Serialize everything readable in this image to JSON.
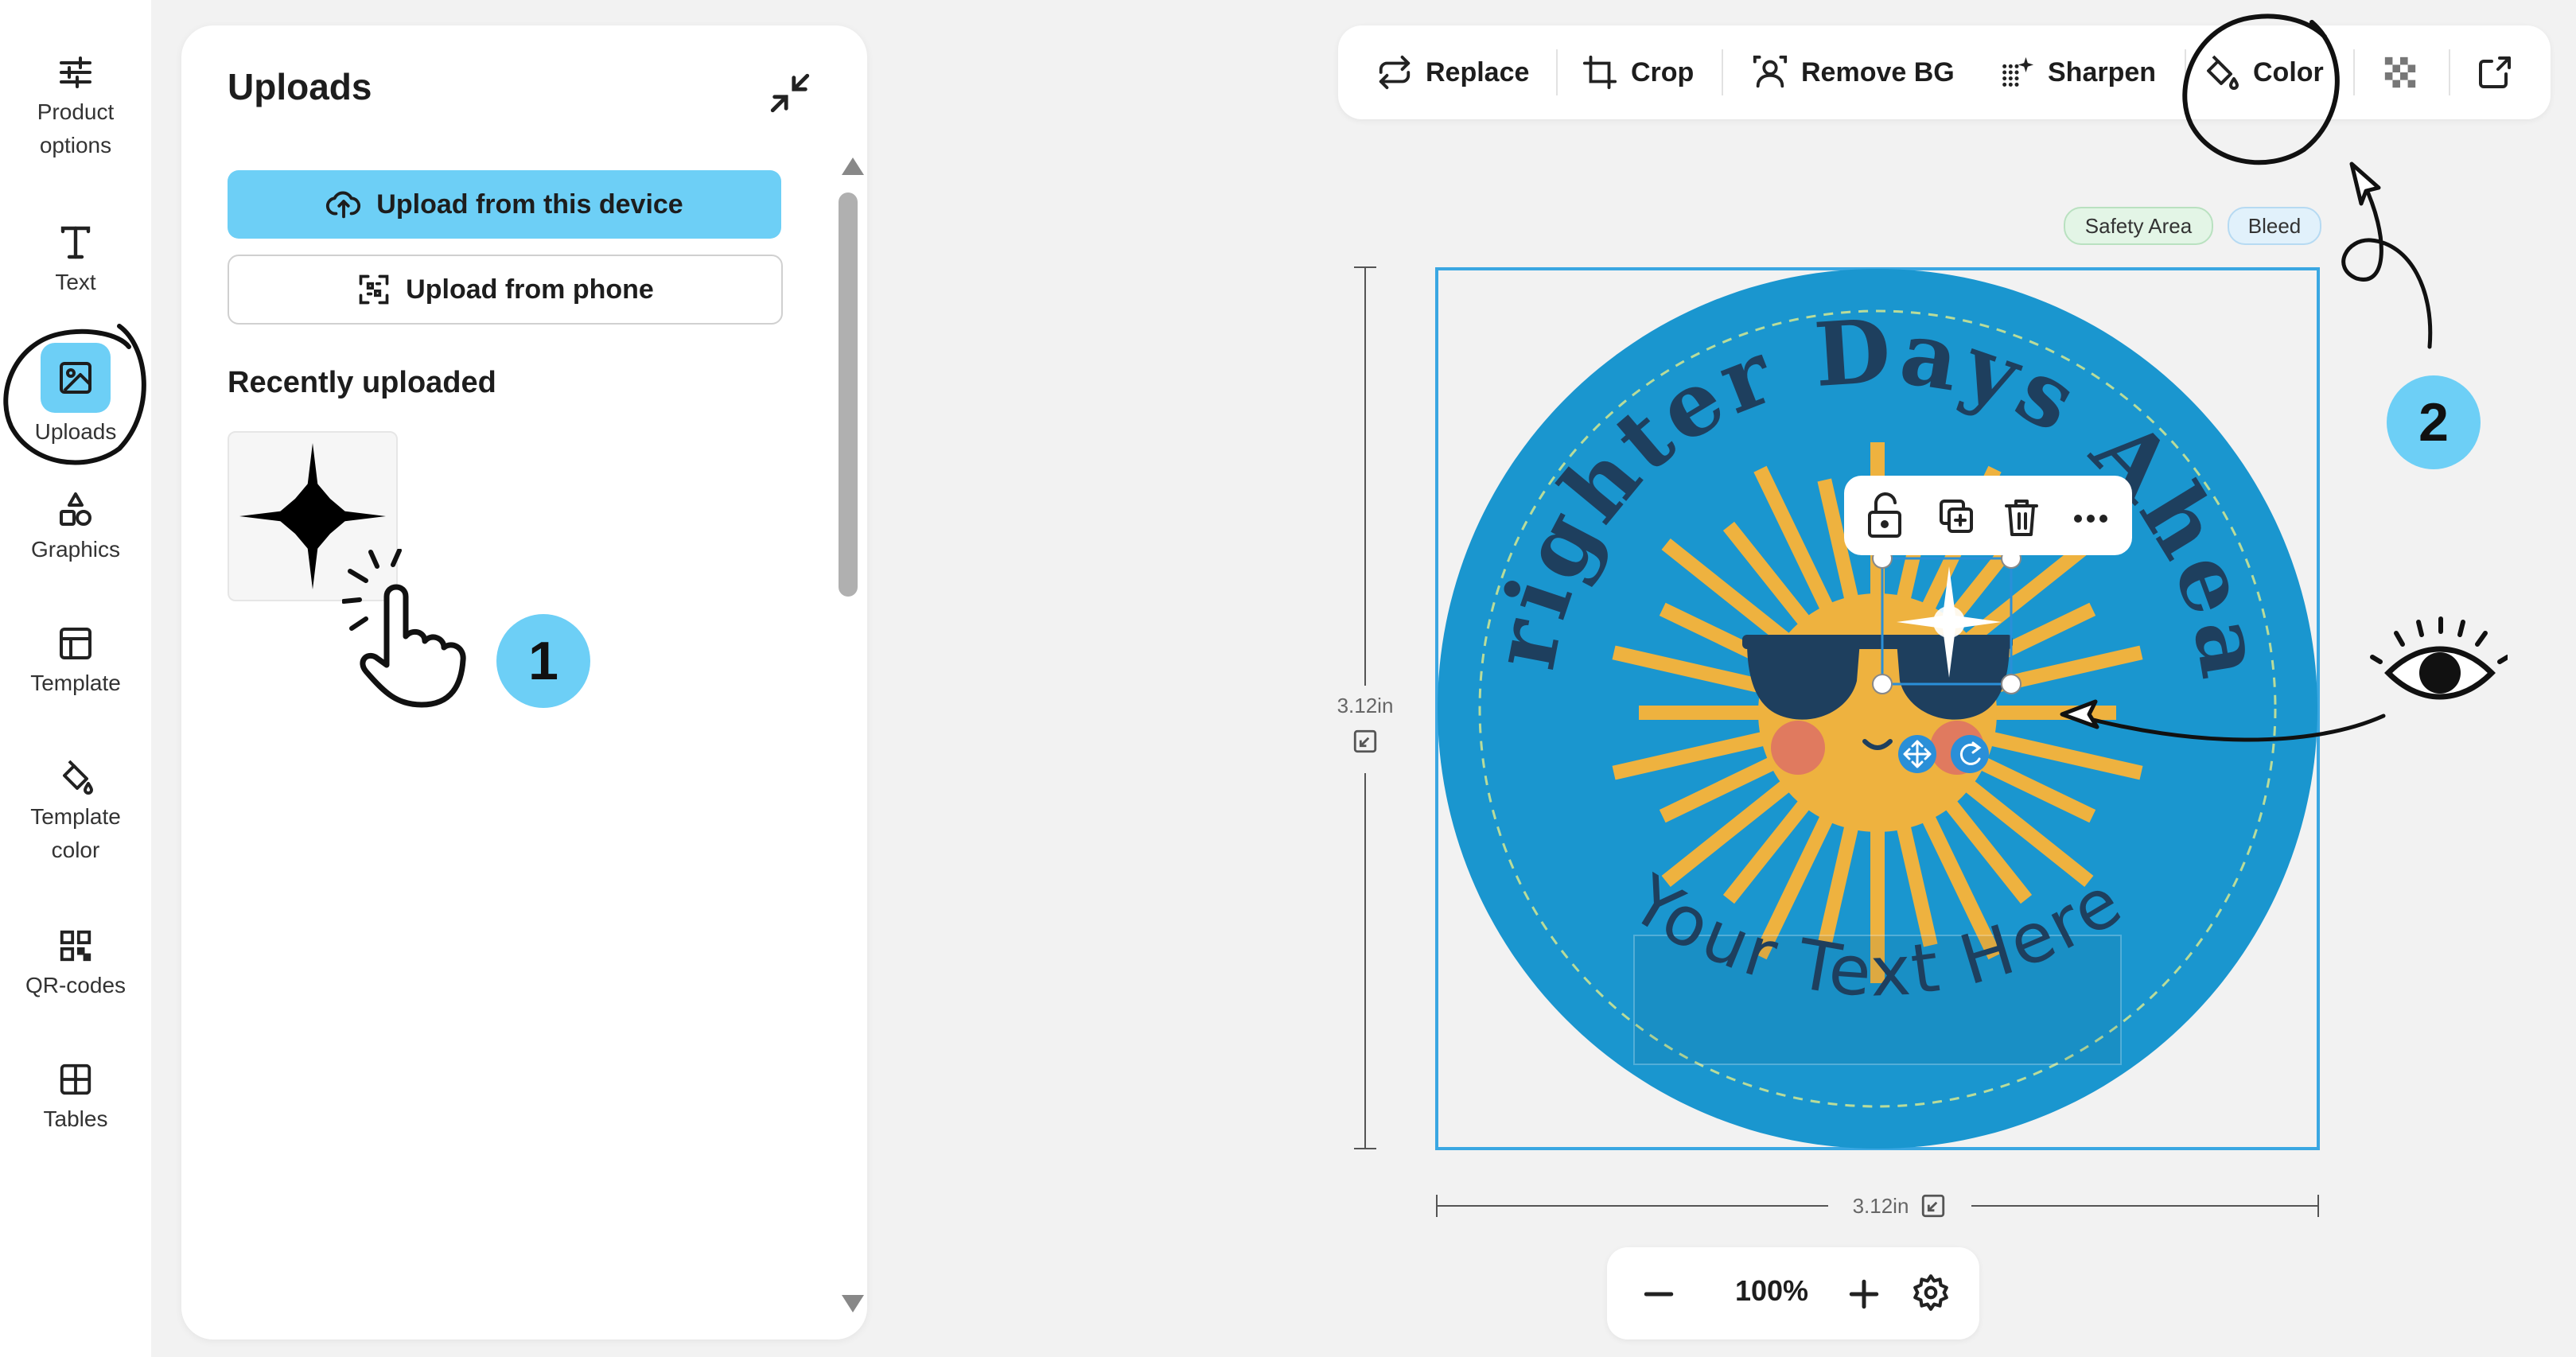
{
  "sidebar": {
    "items": [
      {
        "label_line1": "Product",
        "label_line2": "options",
        "icon": "sliders-icon"
      },
      {
        "label_line1": "Text",
        "label_line2": "",
        "icon": "text-icon"
      },
      {
        "label_line1": "Uploads",
        "label_line2": "",
        "icon": "image-icon",
        "active": true
      },
      {
        "label_line1": "Graphics",
        "label_line2": "",
        "icon": "shapes-icon"
      },
      {
        "label_line1": "Template",
        "label_line2": "",
        "icon": "template-icon"
      },
      {
        "label_line1": "Template",
        "label_line2": "color",
        "icon": "paint-bucket-icon"
      },
      {
        "label_line1": "QR-codes",
        "label_line2": "",
        "icon": "qr-code-icon"
      },
      {
        "label_line1": "Tables",
        "label_line2": "",
        "icon": "table-icon"
      }
    ]
  },
  "uploads": {
    "title": "Uploads",
    "upload_device_label": "Upload from this device",
    "upload_phone_label": "Upload from phone",
    "recent_title": "Recently uploaded"
  },
  "toolbar": {
    "replace": "Replace",
    "crop": "Crop",
    "remove_bg": "Remove BG",
    "sharpen": "Sharpen",
    "color": "Color"
  },
  "canvas": {
    "safety_area": "Safety Area",
    "bleed": "Bleed",
    "height_label": "3.12in",
    "width_label": "3.12in",
    "design_title": "Brighter Days Ahead",
    "design_placeholder": "Your Text Here"
  },
  "zoom": {
    "value": "100%"
  },
  "annotations": {
    "step1": "1",
    "step2": "2"
  },
  "colors": {
    "accent": "#6dcff6",
    "design_blue": "#1a96cf",
    "sun": "#eeb23f",
    "title_dark": "#1e3f5e"
  }
}
